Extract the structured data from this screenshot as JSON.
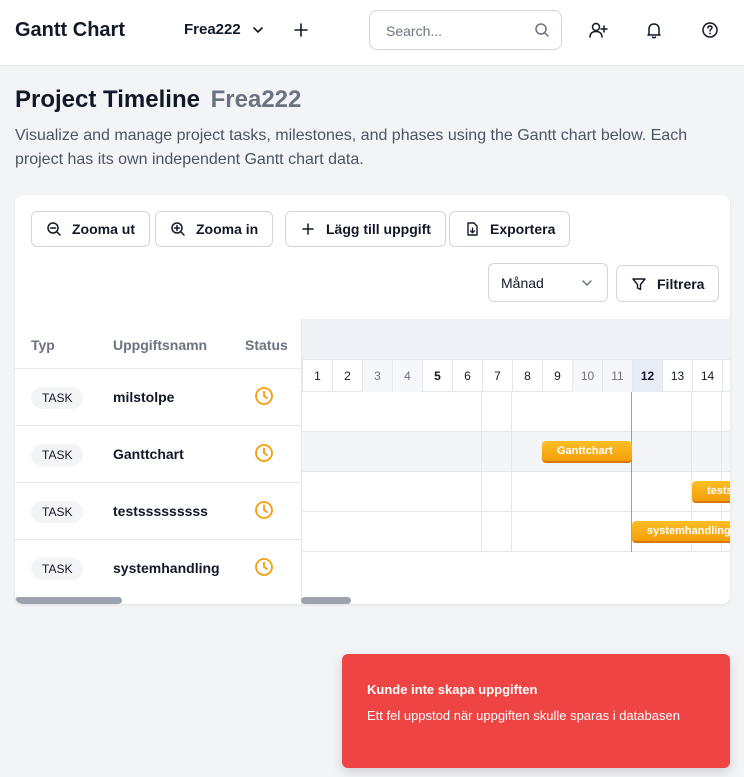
{
  "header": {
    "app_title": "Gantt Chart",
    "project_name": "Frea222",
    "search_placeholder": "Search...",
    "icons": [
      "plus-icon",
      "search-icon",
      "user-plus-icon",
      "bell-icon",
      "help-icon"
    ]
  },
  "page": {
    "title": "Project Timeline",
    "project": "Frea222",
    "description": "Visualize and manage project tasks, milestones, and phases using the Gantt chart below. Each project has its own independent Gantt chart data."
  },
  "toolbar": {
    "zoom_out": "Zooma ut",
    "zoom_in": "Zooma in",
    "add_task": "Lägg till uppgift",
    "export": "Exportera",
    "view_mode": "Månad",
    "filter": "Filtrera"
  },
  "tasklist": {
    "columns": [
      "Typ",
      "Uppgiftsnamn",
      "Status"
    ],
    "rows": [
      {
        "type": "TASK",
        "name": "milstolpe",
        "status": "clock-icon"
      },
      {
        "type": "TASK",
        "name": "Ganttchart",
        "status": "clock-icon"
      },
      {
        "type": "TASK",
        "name": "testsssssssss",
        "status": "clock-icon"
      },
      {
        "type": "TASK",
        "name": "systemhandling",
        "status": "clock-icon"
      }
    ]
  },
  "gantt": {
    "days": [
      "1",
      "2",
      "3",
      "4",
      "5",
      "6",
      "7",
      "8",
      "9",
      "10",
      "11",
      "12",
      "13",
      "14"
    ],
    "today": "12",
    "bars": [
      {
        "label": "Ganttchart"
      },
      {
        "label": "testsssssssss"
      },
      {
        "label": "systemhandling"
      }
    ],
    "bar_color": "#f59e0b"
  },
  "toast": {
    "title": "Kunde inte skapa uppgiften",
    "message": "Ett fel uppstod när uppgiften skulle sparas i databasen",
    "color": "#ef4444"
  }
}
